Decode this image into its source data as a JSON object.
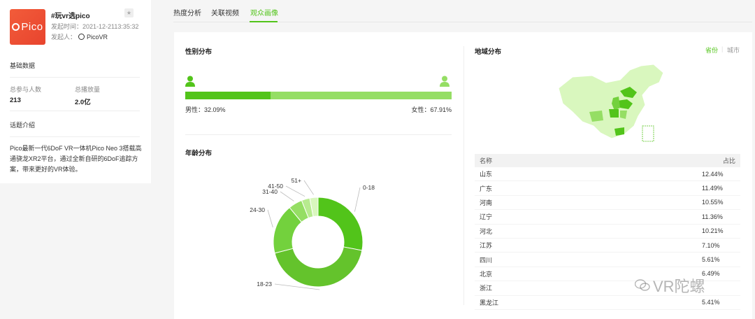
{
  "topic": {
    "logo_text": "Pico",
    "title": "#玩vr选pico",
    "time_label": "发起时间：",
    "time_value": "2021-12-2113:35:32",
    "author_label": "发起人：",
    "author_name": "PicoVR"
  },
  "basic": {
    "section_title": "基础数据",
    "participants_label": "总参与人数",
    "participants_value": "213",
    "plays_label": "总播放量",
    "plays_value": "2.0亿"
  },
  "intro": {
    "section_title": "话题介绍",
    "text": "Pico最新一代6DoF VR一体机Pico Neo 3搭载高通骁龙XR2平台，通过全新自研的6DoF追踪方案，带来更好的VR体验。"
  },
  "tabs": [
    "热度分析",
    "关联视频",
    "观众画像"
  ],
  "gender": {
    "title": "性别分布",
    "male_label": "男性：32.09%",
    "female_label": "女性：67.91%",
    "male_fraction": 0.3209,
    "colors": {
      "male": "#52c41a",
      "female": "#95de64"
    }
  },
  "age": {
    "title": "年龄分布",
    "labels": [
      "0-18",
      "18-23",
      "24-30",
      "31-40",
      "41-50",
      "51+"
    ]
  },
  "chart_data": {
    "type": "pie",
    "categories": [
      "0-18",
      "18-23",
      "24-30",
      "31-40",
      "41-50",
      "51+"
    ],
    "values": [
      28,
      43,
      18,
      5,
      3,
      3
    ],
    "colors": [
      "#52c41a",
      "#64c32c",
      "#73d13d",
      "#95de64",
      "#b7eb8f",
      "#d9f7be"
    ]
  },
  "region": {
    "title": "地域分布",
    "toggle_province": "省份",
    "toggle_city": "城市",
    "col_name": "名称",
    "col_pct": "占比",
    "rows": [
      {
        "name": "山东",
        "pct": "12.44%"
      },
      {
        "name": "广东",
        "pct": "11.49%"
      },
      {
        "name": "河南",
        "pct": "10.55%"
      },
      {
        "name": "辽宁",
        "pct": "11.36%"
      },
      {
        "name": "河北",
        "pct": "10.21%"
      },
      {
        "name": "江苏",
        "pct": "7.10%"
      },
      {
        "name": "四川",
        "pct": "5.61%"
      },
      {
        "name": "北京",
        "pct": "6.49%"
      },
      {
        "name": "浙江",
        "pct": ""
      },
      {
        "name": "黑龙江",
        "pct": "5.41%"
      }
    ]
  },
  "watermark": "VR陀螺"
}
